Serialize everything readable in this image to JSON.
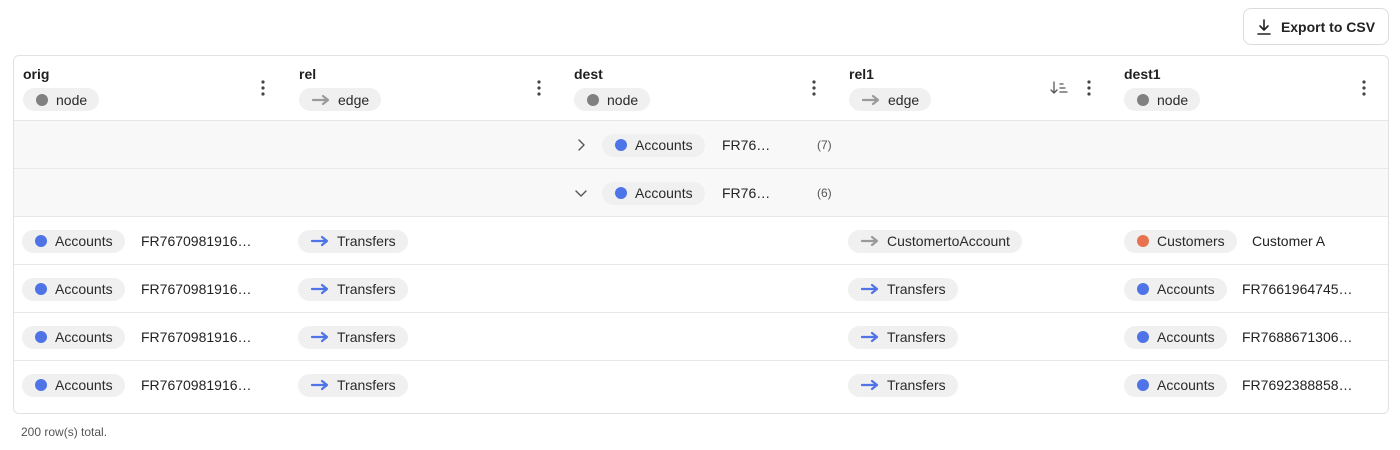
{
  "toolbar": {
    "export_label": "Export to CSV",
    "export_icon": "download-icon"
  },
  "colors": {
    "node_grey": "#808080",
    "accounts": "#4f74e8",
    "customers": "#e8724f",
    "edge_grey": "#9a9a9a",
    "transfers": "#4f74e8"
  },
  "columns": [
    {
      "name": "orig",
      "type": "node"
    },
    {
      "name": "rel",
      "type": "edge"
    },
    {
      "name": "dest",
      "type": "node"
    },
    {
      "name": "rel1",
      "type": "edge"
    },
    {
      "name": "dest1",
      "type": "node"
    }
  ],
  "groups": [
    {
      "label": "Accounts",
      "value": "FR76…",
      "count": "(7)",
      "expanded": false
    },
    {
      "label": "Accounts",
      "value": "FR76…",
      "count": "(6)",
      "expanded": true
    }
  ],
  "rows": [
    {
      "orig_label": "Accounts",
      "orig_value": "FR7670981916…",
      "rel_label": "Transfers",
      "rel1_label": "CustomertoAccount",
      "dest1_label": "Customers",
      "dest1_value": "Customer A"
    },
    {
      "orig_label": "Accounts",
      "orig_value": "FR7670981916…",
      "rel_label": "Transfers",
      "rel1_label": "Transfers",
      "dest1_label": "Accounts",
      "dest1_value": "FR7661964745…"
    },
    {
      "orig_label": "Accounts",
      "orig_value": "FR7670981916…",
      "rel_label": "Transfers",
      "rel1_label": "Transfers",
      "dest1_label": "Accounts",
      "dest1_value": "FR7688671306…"
    },
    {
      "orig_label": "Accounts",
      "orig_value": "FR7670981916…",
      "rel_label": "Transfers",
      "rel1_label": "Transfers",
      "dest1_label": "Accounts",
      "dest1_value": "FR7692388858…"
    }
  ],
  "footer": {
    "total_text": "200 row(s) total."
  }
}
